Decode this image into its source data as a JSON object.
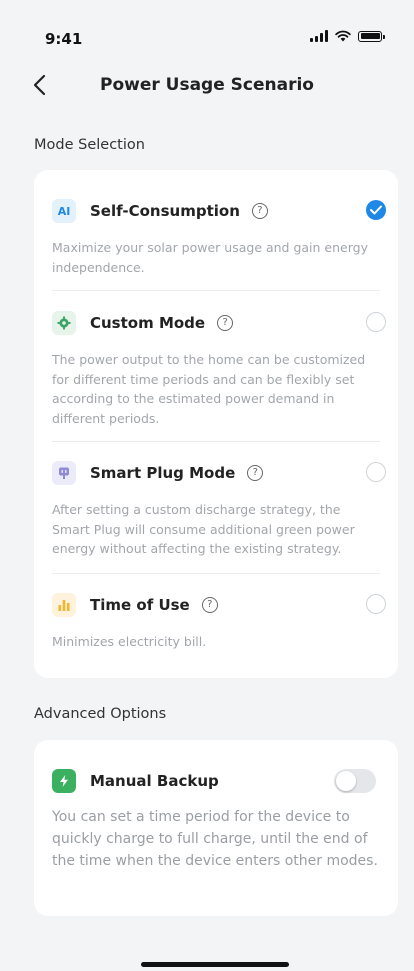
{
  "status_bar": {
    "time": "9:41"
  },
  "header": {
    "title": "Power Usage Scenario"
  },
  "mode_section": {
    "title": "Mode Selection",
    "modes": [
      {
        "icon_label": "AI",
        "icon": "ai-icon",
        "name": "Self-Consumption",
        "description": "Maximize your solar power usage and gain energy independence.",
        "selected": true
      },
      {
        "icon": "gear-icon",
        "name": "Custom Mode",
        "description": "The power output to the home can be customized for different time periods and can be flexibly set according to the estimated power demand in different periods.",
        "selected": false
      },
      {
        "icon": "plug-icon",
        "name": "Smart Plug Mode",
        "description": "After setting a custom discharge strategy, the Smart Plug will consume additional green power energy without affecting the existing strategy.",
        "selected": false
      },
      {
        "icon": "bar-chart-icon",
        "name": "Time of Use",
        "description": "Minimizes electricity bill.",
        "selected": false
      }
    ]
  },
  "advanced_section": {
    "title": "Advanced Options",
    "manual_backup": {
      "icon": "lightning-icon",
      "name": "Manual Backup",
      "enabled": false,
      "description": "You can set a time period for the device to quickly charge to full charge, until the end of the time when the device enters other modes."
    }
  },
  "colors": {
    "accent": "#1f87e5",
    "background": "#f3f4f6",
    "ai_icon_bg": "#e3f1fb",
    "custom_icon": "#3fa566",
    "plug_icon": "#8f8ad6",
    "tou_icon": "#f2b52d",
    "backup_icon": "#3bb061"
  }
}
